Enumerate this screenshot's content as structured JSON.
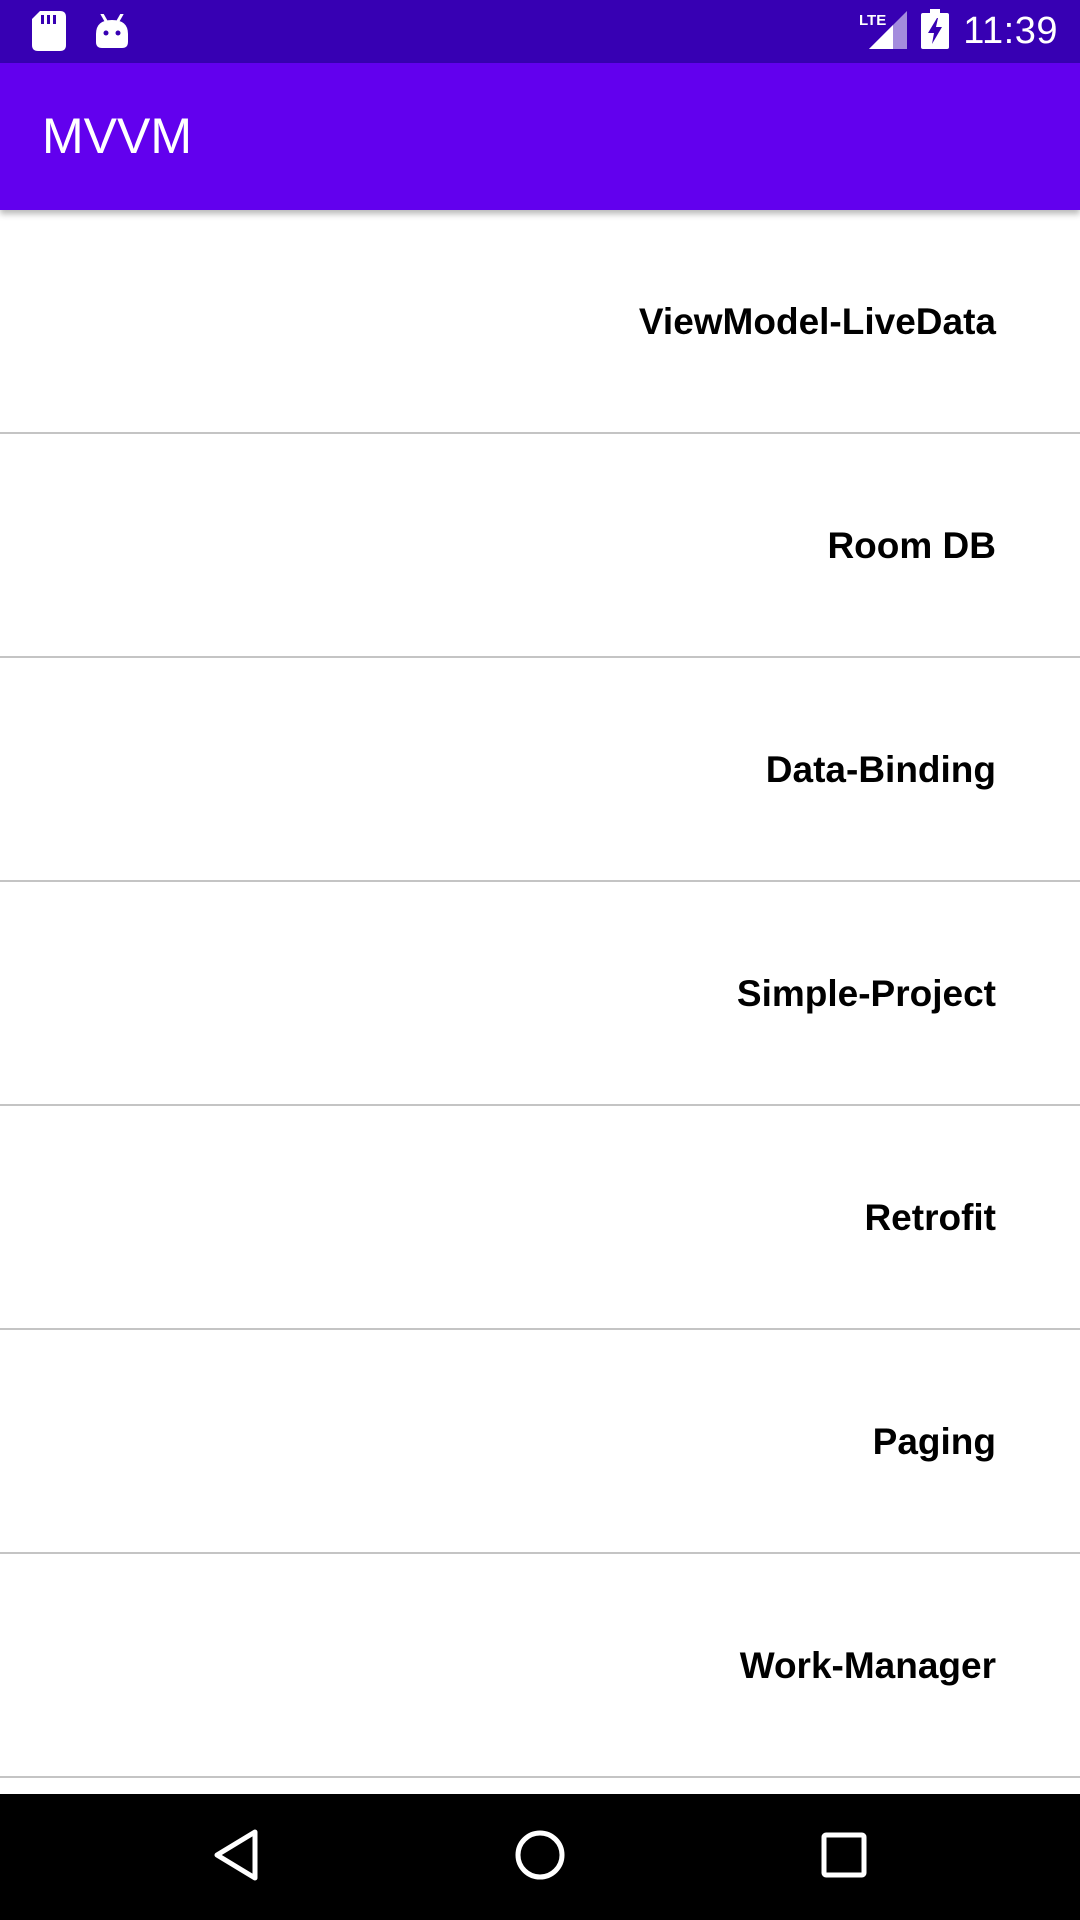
{
  "status_bar": {
    "time": "11:39",
    "network_label": "LTE",
    "left_icons": [
      "sd-card-icon",
      "android-icon"
    ],
    "right_icons": [
      "lte-signal-icon",
      "battery-charging-icon"
    ]
  },
  "app_bar": {
    "title": "MVVM",
    "color": "#6200ee"
  },
  "list": {
    "items": [
      {
        "label": "ViewModel-LiveData"
      },
      {
        "label": "Room DB"
      },
      {
        "label": "Data-Binding"
      },
      {
        "label": "Simple-Project"
      },
      {
        "label": "Retrofit"
      },
      {
        "label": "Paging"
      },
      {
        "label": "Work-Manager"
      },
      {
        "label": ""
      }
    ]
  },
  "nav_bar": {
    "buttons": [
      "back-icon",
      "home-icon",
      "recents-icon"
    ]
  },
  "colors": {
    "status_bar": "#3700b3",
    "app_bar": "#6200ee",
    "divider": "#c4c4c4",
    "nav_bar": "#000000"
  }
}
